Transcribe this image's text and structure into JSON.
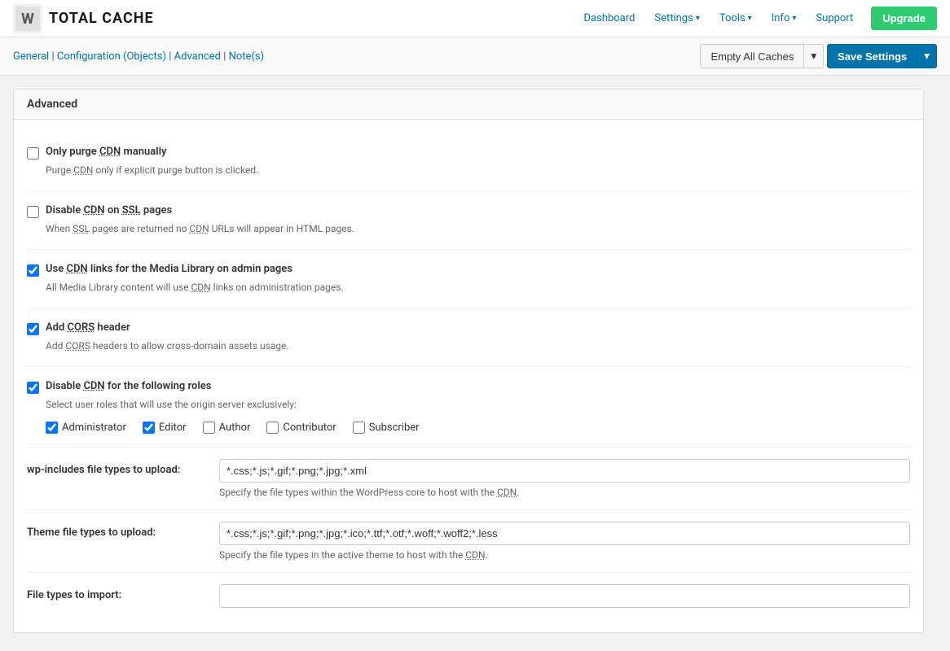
{
  "app": {
    "logo_text": "TOTAL CACHE",
    "logo_subtext": ""
  },
  "nav": {
    "dashboard": "Dashboard",
    "settings": "Settings",
    "tools": "Tools",
    "info": "Info",
    "support": "Support",
    "upgrade": "Upgrade",
    "chevron": "▾"
  },
  "breadcrumb": {
    "general": "General",
    "configuration": "Configuration (Objects)",
    "advanced": "Advanced",
    "notes": "Note(s)",
    "separator": "|"
  },
  "buttons": {
    "empty_caches": "Empty All Caches",
    "save_settings": "Save Settings",
    "dropdown_arrow": "▾"
  },
  "section": {
    "title": "Advanced"
  },
  "settings": {
    "purge_cdn": {
      "label": "Only purge CDN manually",
      "abbr": "CDN",
      "desc": "Purge CDN only if explicit purge button is clicked.",
      "desc_abbr": "CDN",
      "checked": false
    },
    "disable_cdn_ssl": {
      "label": "Disable CDN on SSL pages",
      "abbr": "CDN",
      "ssl_abbr": "SSL",
      "desc": "When SSL pages are returned no CDN URLs will appear in HTML pages.",
      "checked": false
    },
    "cdn_media_library": {
      "label": "Use CDN links for the Media Library on admin pages",
      "abbr": "CDN",
      "desc": "All Media Library content will use CDN links on administration pages.",
      "desc_abbr": "CDN",
      "checked": true
    },
    "cors_header": {
      "label": "Add CORS header",
      "abbr": "CORS",
      "desc": "Add CORS headers to allow cross-domain assets usage.",
      "desc_abbr": "CORS",
      "checked": true
    },
    "disable_cdn_roles": {
      "label": "Disable CDN for the following roles",
      "abbr": "CDN",
      "desc": "Select user roles that will use the origin server exclusively:",
      "checked": true,
      "roles": [
        {
          "name": "Administrator",
          "checked": true
        },
        {
          "name": "Editor",
          "checked": true
        },
        {
          "name": "Author",
          "checked": false
        },
        {
          "name": "Contributor",
          "checked": false
        },
        {
          "name": "Subscriber",
          "checked": false
        }
      ]
    }
  },
  "form_fields": {
    "wp_includes": {
      "label": "wp-includes file types to upload:",
      "value": "*.css;*.js;*.gif;*.png;*.jpg;*.xml",
      "hint": "Specify the file types within the WordPress core to host with the CDN.",
      "hint_abbr": "CDN"
    },
    "theme_types": {
      "label": "Theme file types to upload:",
      "value": "*.css;*.js;*.gif;*.png;*.jpg;*.ico;*.ttf;*.otf;*.woff;*.woff2;*.less",
      "hint": "Specify the file types in the active theme to host with the CDN.",
      "hint_abbr": "CDN"
    },
    "file_types_import": {
      "label": "File types to import:",
      "value": "",
      "hint": ""
    }
  }
}
